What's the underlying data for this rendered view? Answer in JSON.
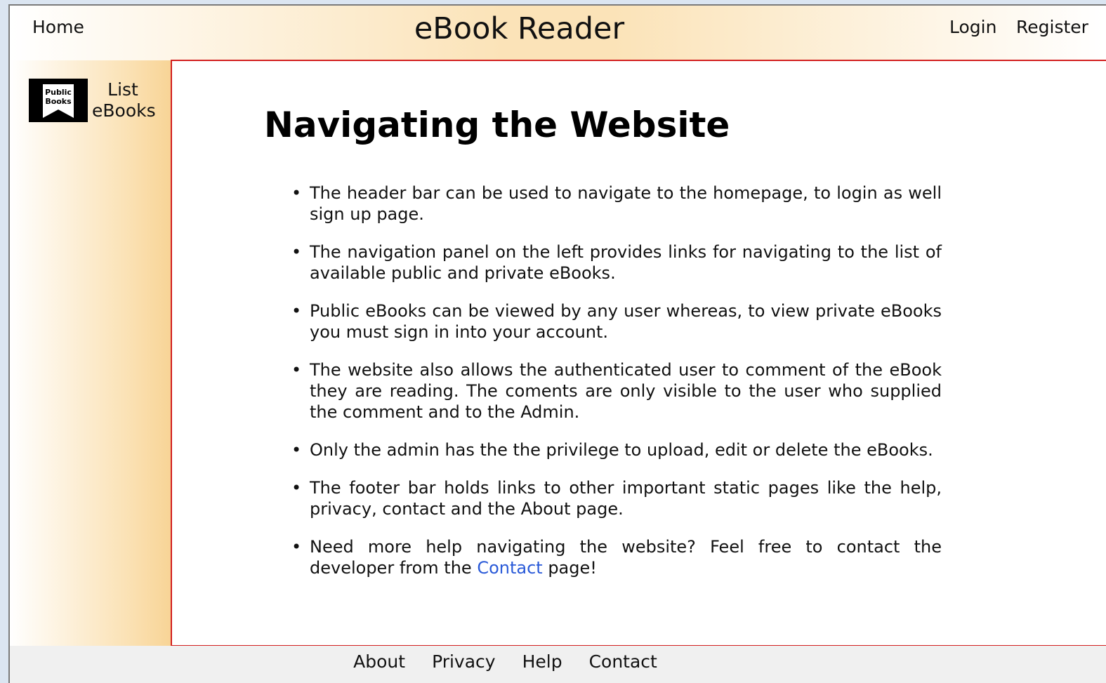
{
  "header": {
    "home_label": "Home",
    "title": "eBook Reader",
    "login_label": "Login",
    "register_label": "Register"
  },
  "sidebar": {
    "logo_icon": "public-books-logo",
    "logo_text_line1": "Public",
    "logo_text_line2": "Books",
    "items": [
      {
        "label_line1": "List",
        "label_line2": "eBooks"
      }
    ]
  },
  "main": {
    "heading": "Navigating the Website",
    "items": [
      {
        "text": "The header bar can be used to navigate to the homepage, to login as well sign up page."
      },
      {
        "text": "The navigation panel on the left provides links for navigating to the list of available public and private eBooks."
      },
      {
        "text": "Public eBooks can be viewed by any user whereas, to view private eBooks you must sign in into your account."
      },
      {
        "text": "The website also allows the authenticated user to comment of the eBook they are reading. The coments are only visible to the user who supplied the comment and to the Admin."
      },
      {
        "text": "Only the admin has the the privilege to upload, edit or delete the eBooks."
      },
      {
        "text": "The footer bar holds links to other important static pages like the help, privacy, contact and the About page."
      },
      {
        "text_before": "Need more help navigating the website? Feel free to contact the developer from the ",
        "link": "Contact",
        "text_after": " page!"
      }
    ],
    "link_color": "#2a5ad8"
  },
  "footer": {
    "links": [
      "About",
      "Privacy",
      "Help",
      "Contact"
    ]
  },
  "colors": {
    "accent_border": "#d21f1f",
    "header_gradient": "#fbe3b8"
  }
}
